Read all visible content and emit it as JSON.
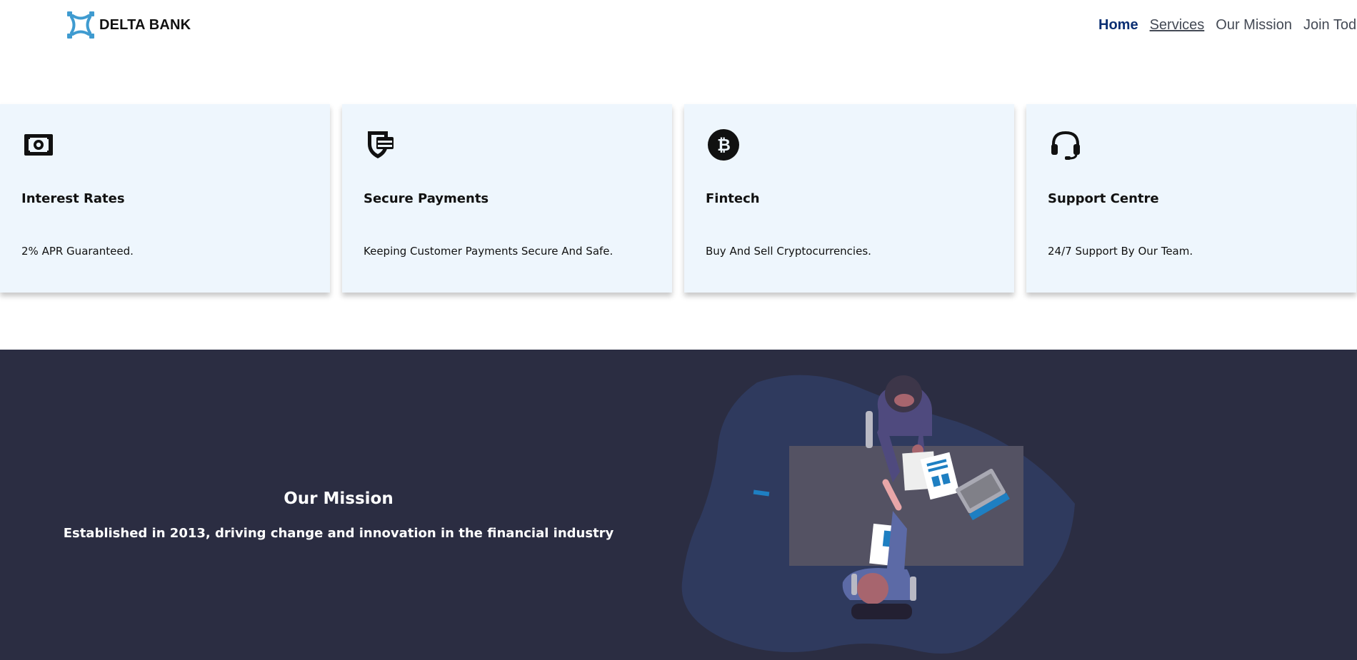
{
  "brand": {
    "name": "DELTA BANK",
    "accent": "#3f9bd0"
  },
  "nav": {
    "items": [
      {
        "label": "Home",
        "state": "active"
      },
      {
        "label": "Services",
        "state": "hover"
      },
      {
        "label": "Our Mission",
        "state": "default"
      },
      {
        "label": "Join Today",
        "state": "default"
      }
    ]
  },
  "cards": [
    {
      "icon": "money-icon",
      "title": "Interest Rates",
      "text": "2% APR Guaranteed."
    },
    {
      "icon": "shield-card-icon",
      "title": "Secure Payments",
      "text": "Keeping Customer Payments Secure And Safe."
    },
    {
      "icon": "bitcoin-icon",
      "title": "Fintech",
      "text": "Buy And Sell Cryptocurrencies."
    },
    {
      "icon": "headset-icon",
      "title": "Support Centre",
      "text": "24/7 Support By Our Team."
    }
  ],
  "mission": {
    "title": "Our Mission",
    "subtitle": "Established in 2013, driving change and innovation in the financial industry",
    "background": "#2b2d42"
  }
}
